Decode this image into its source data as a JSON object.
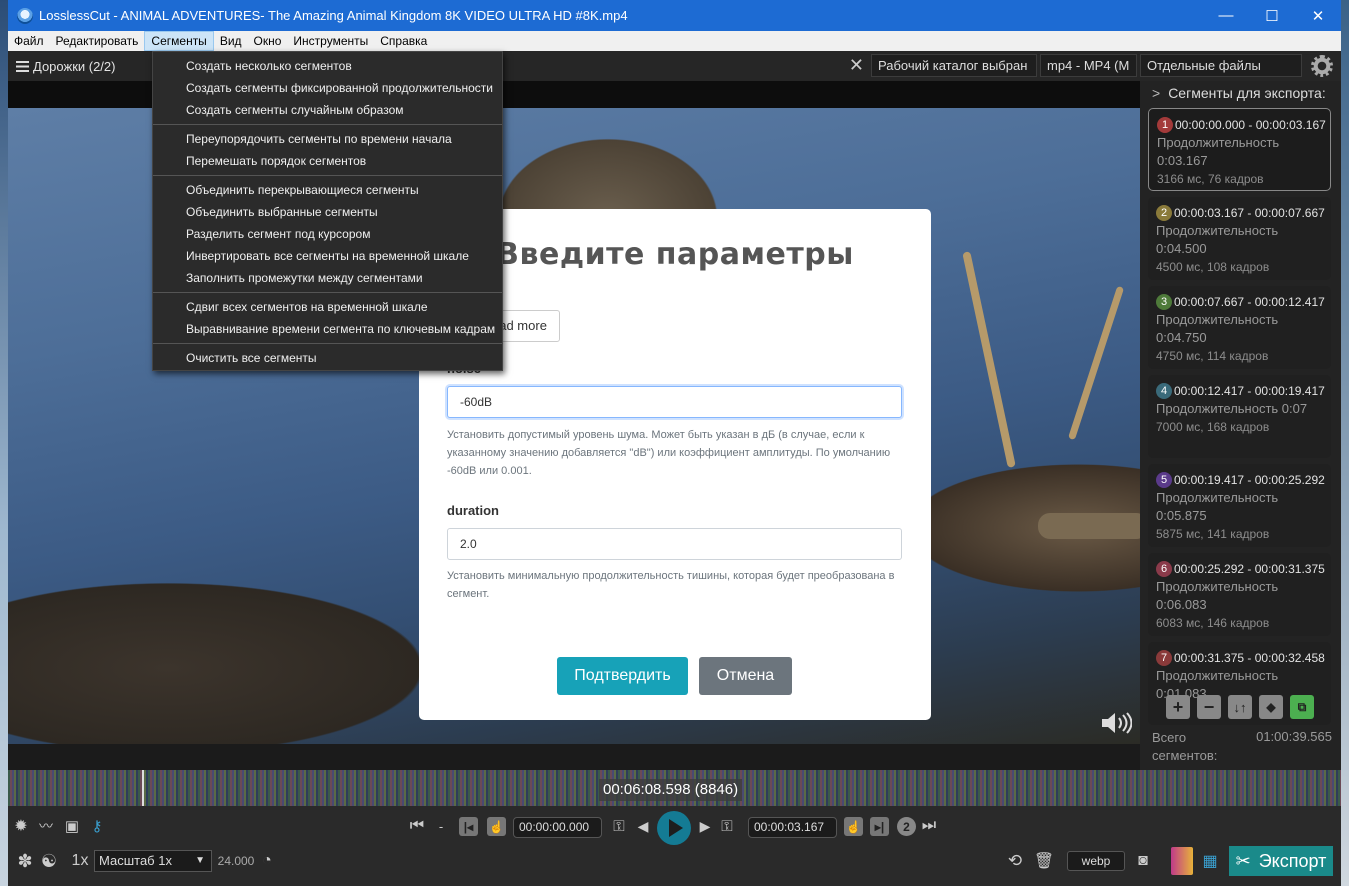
{
  "window": {
    "title": "LosslessCut - ANIMAL ADVENTURES- The Amazing Animal Kingdom 8K VIDEO ULTRA HD #8K.mp4",
    "minimize": "—",
    "maximize": "☐",
    "close": "✕"
  },
  "menu": {
    "items": [
      "Файл",
      "Редактировать",
      "Сегменты",
      "Вид",
      "Окно",
      "Инструменты",
      "Справка"
    ],
    "active": "Сегменты"
  },
  "toolbar": {
    "tracks_label": "Дорожки (2/2)",
    "workdir": "Рабочий каталог выбран",
    "format": "mp4 - MP4 (M",
    "output_mode": "Отдельные файлы"
  },
  "dropdown": {
    "group1": [
      "Создать несколько сегментов",
      "Создать сегменты фиксированной продолжительности",
      "Создать сегменты случайным образом"
    ],
    "group2": [
      "Переупорядочить сегменты по времени начала",
      "Перемешать порядок сегментов"
    ],
    "group3": [
      "Объединить перекрывающиеся сегменты",
      "Объединить выбранные сегменты",
      "Разделить сегмент под курсором",
      "Инвертировать все сегменты на временной шкале",
      "Заполнить промежутки между сегментами"
    ],
    "group4": [
      "Сдвиг всех сегментов на временной шкале",
      "Выравнивание времени сегмента по ключевым кадрам"
    ],
    "group5": [
      "Очистить все сегменты"
    ]
  },
  "modal": {
    "title": "Введите параметры",
    "read_more": "ead more",
    "noise_label": "noise",
    "noise_value": "-60dB",
    "noise_help": "Установить допустимый уровень шума. Может быть указан в дБ (в случае, если к указанному значению добавляется \"dB\") или коэффициент амплитуды. По умолчанию -60dB или 0.001.",
    "duration_label": "duration",
    "duration_value": "2.0",
    "duration_help": "Установить минимальную продолжительность тишины, которая будет преобразована в сегмент.",
    "confirm": "Подтвердить",
    "cancel": "Отмена"
  },
  "segments_panel": {
    "header": "Сегменты для экспорта:",
    "segments": [
      {
        "num": "1",
        "range": "00:00:00.000 - 00:00:03.167",
        "duration_label": "Продолжительность",
        "duration": "0:03.167",
        "frames": "3166 мс, 76 кадров",
        "color": "#a33a3a"
      },
      {
        "num": "2",
        "range": "00:00:03.167 - 00:00:07.667",
        "duration_label": "Продолжительность",
        "duration": "0:04.500",
        "frames": "4500 мс, 108 кадров",
        "color": "#8a7a3a"
      },
      {
        "num": "3",
        "range": "00:00:07.667 - 00:00:12.417",
        "duration_label": "Продолжительность",
        "duration": "0:04.750",
        "frames": "4750 мс, 114 кадров",
        "color": "#4e7a3a"
      },
      {
        "num": "4",
        "range": "00:00:12.417 - 00:00:19.417",
        "duration_label": "Продолжительность 0:07",
        "duration": "",
        "frames": "7000 мс, 168 кадров",
        "color": "#3a6a7a"
      },
      {
        "num": "5",
        "range": "00:00:19.417 - 00:00:25.292",
        "duration_label": "Продолжительность",
        "duration": "0:05.875",
        "frames": "5875 мс, 141 кадров",
        "color": "#5a3a8a"
      },
      {
        "num": "6",
        "range": "00:00:25.292 - 00:00:31.375",
        "duration_label": "Продолжительность",
        "duration": "0:06.083",
        "frames": "6083 мс, 146 кадров",
        "color": "#8a3a4a"
      },
      {
        "num": "7",
        "range": "00:00:31.375 - 00:00:32.458",
        "duration_label": "Продолжительность",
        "duration": "0:01.083",
        "frames": "",
        "color": "#8a3a3a"
      }
    ],
    "total_label": "Всего сегментов:",
    "total_value": "01:00:39.565"
  },
  "timeline": {
    "timecode": "00:06:08.598 (8846)"
  },
  "controls": {
    "dash": "-",
    "start_time": "00:00:00.000",
    "end_time": "00:00:03.167",
    "segment_num": "2",
    "speed": "1x",
    "zoom": "Масштаб 1x",
    "fps": "24.000",
    "snapshot_format": "webp",
    "export": "Экспорт"
  }
}
